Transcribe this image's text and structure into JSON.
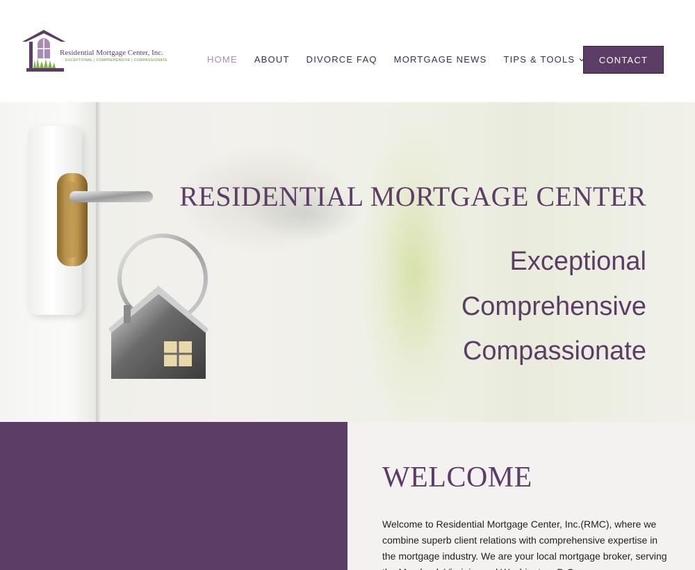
{
  "logo": {
    "name": "Residential Mortgage Center, Inc.",
    "tagline": "EXCEPTIONAL | COMPREHENSIVE | COMPASSIONATE"
  },
  "nav": {
    "items": [
      {
        "label": "HOME",
        "active": true
      },
      {
        "label": "ABOUT",
        "active": false
      },
      {
        "label": "DIVORCE FAQ",
        "active": false
      },
      {
        "label": "MORTGAGE NEWS",
        "active": false
      },
      {
        "label": "TIPS & TOOLS",
        "active": false,
        "has_dropdown": true
      }
    ],
    "contact_label": "CONTACT"
  },
  "hero": {
    "title": "RESIDENTIAL MORTGAGE CENTER",
    "lines": [
      "Exceptional",
      "Comprehensive",
      "Compassionate"
    ]
  },
  "welcome": {
    "title": "WELCOME",
    "text": "Welcome to Residential Mortgage Center, Inc.(RMC), where we combine superb client relations with comprehensive expertise in the mortgage industry. We are your local mortgage broker, serving the Maryland, Virginia, and Washington, D.C. area."
  },
  "colors": {
    "brand_purple": "#5c3d66",
    "nav_active": "#a98bb5",
    "logo_green": "#5b8f3c"
  },
  "icons": {
    "dropdown": "chevron-down-icon",
    "logo": "house-logo-icon",
    "hero_image": "house-key-keychain-image"
  }
}
